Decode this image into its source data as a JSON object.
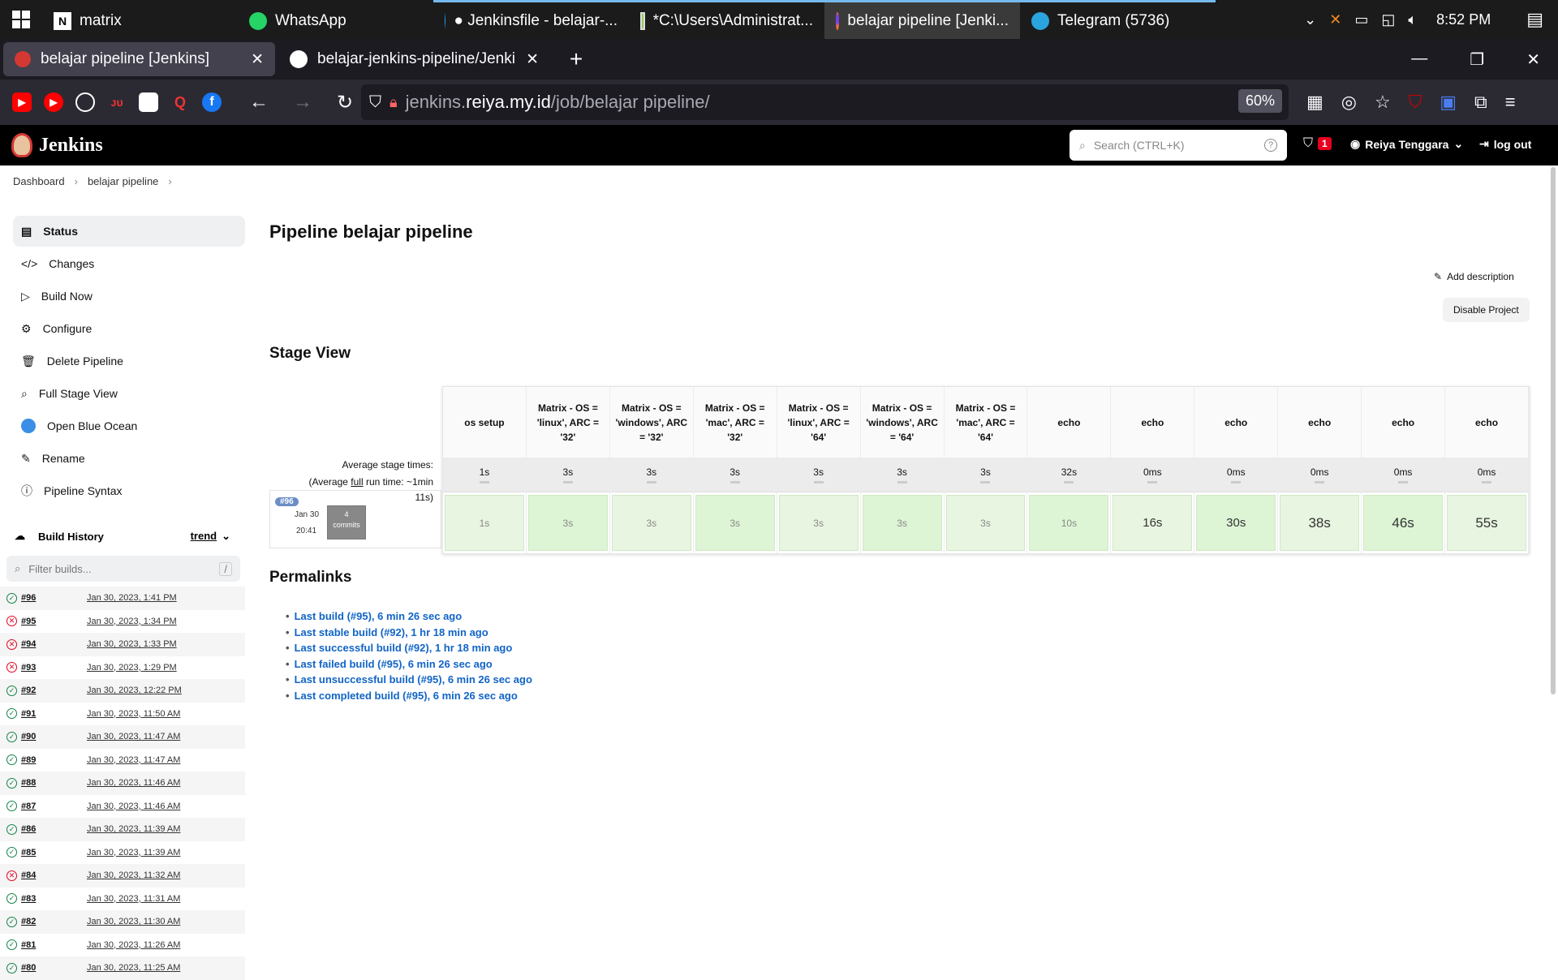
{
  "taskbar": {
    "apps": [
      {
        "label": "matrix",
        "icon": "notion-icon"
      },
      {
        "label": "WhatsApp",
        "icon": "whatsapp-icon"
      },
      {
        "label": "● Jenkinsfile - belajar-...",
        "icon": "vscode-icon"
      },
      {
        "label": "*C:\\Users\\Administrat...",
        "icon": "notepad-icon"
      },
      {
        "label": "belajar pipeline [Jenki...",
        "icon": "firefox-icon"
      },
      {
        "label": "Telegram (5736)",
        "icon": "telegram-icon"
      }
    ],
    "time": "8:52 PM"
  },
  "browser": {
    "tabs": [
      {
        "label": "belajar pipeline [Jenkins]"
      },
      {
        "label": "belajar-jenkins-pipeline/Jenki"
      }
    ],
    "url_prefix": "jenkins.",
    "url_host": "reiya.my.id",
    "url_path": "/job/belajar pipeline/",
    "zoom": "60%"
  },
  "jenkins": {
    "logo": "Jenkins",
    "search_placeholder": "Search (CTRL+K)",
    "alert_count": "1",
    "user": "Reiya Tenggara",
    "logout": "log out"
  },
  "breadcrumb": [
    "Dashboard",
    "belajar pipeline"
  ],
  "sidebar": {
    "items": [
      {
        "label": "Status",
        "icon": "status-icon"
      },
      {
        "label": "Changes",
        "icon": "code-icon"
      },
      {
        "label": "Build Now",
        "icon": "play-icon"
      },
      {
        "label": "Configure",
        "icon": "gear-icon"
      },
      {
        "label": "Delete Pipeline",
        "icon": "trash-icon"
      },
      {
        "label": "Full Stage View",
        "icon": "search-icon"
      },
      {
        "label": "Open Blue Ocean",
        "icon": "blue-ocean-icon"
      },
      {
        "label": "Rename",
        "icon": "pencil-icon"
      },
      {
        "label": "Pipeline Syntax",
        "icon": "help-icon"
      }
    ]
  },
  "build_history": {
    "title": "Build History",
    "trend": "trend",
    "filter_placeholder": "Filter builds...",
    "filter_key": "/",
    "builds": [
      {
        "num": "#96",
        "date": "Jan 30, 2023, 1:41 PM",
        "ok": true
      },
      {
        "num": "#95",
        "date": "Jan 30, 2023, 1:34 PM",
        "ok": false
      },
      {
        "num": "#94",
        "date": "Jan 30, 2023, 1:33 PM",
        "ok": false
      },
      {
        "num": "#93",
        "date": "Jan 30, 2023, 1:29 PM",
        "ok": false
      },
      {
        "num": "#92",
        "date": "Jan 30, 2023, 12:22 PM",
        "ok": true
      },
      {
        "num": "#91",
        "date": "Jan 30, 2023, 11:50 AM",
        "ok": true
      },
      {
        "num": "#90",
        "date": "Jan 30, 2023, 11:47 AM",
        "ok": true
      },
      {
        "num": "#89",
        "date": "Jan 30, 2023, 11:47 AM",
        "ok": true
      },
      {
        "num": "#88",
        "date": "Jan 30, 2023, 11:46 AM",
        "ok": true
      },
      {
        "num": "#87",
        "date": "Jan 30, 2023, 11:46 AM",
        "ok": true
      },
      {
        "num": "#86",
        "date": "Jan 30, 2023, 11:39 AM",
        "ok": true
      },
      {
        "num": "#85",
        "date": "Jan 30, 2023, 11:39 AM",
        "ok": true
      },
      {
        "num": "#84",
        "date": "Jan 30, 2023, 11:32 AM",
        "ok": false
      },
      {
        "num": "#83",
        "date": "Jan 30, 2023, 11:31 AM",
        "ok": true
      },
      {
        "num": "#82",
        "date": "Jan 30, 2023, 11:30 AM",
        "ok": true
      },
      {
        "num": "#81",
        "date": "Jan 30, 2023, 11:26 AM",
        "ok": true
      },
      {
        "num": "#80",
        "date": "Jan 30, 2023, 11:25 AM",
        "ok": true
      }
    ]
  },
  "main": {
    "title": "Pipeline belajar pipeline",
    "add_description": "Add description",
    "disable_project": "Disable Project",
    "stage_view_title": "Stage View",
    "avg_label": "Average stage times:",
    "avg_full_prefix": "(Average ",
    "avg_full_word": "full",
    "avg_full_suffix": " run time: ~1min",
    "avg_full_tail": "11s)",
    "build_badge": "#96",
    "build_date": "Jan 30",
    "build_time": "20:41",
    "commits_count": "4",
    "commits_label": "commits",
    "stages": [
      {
        "name": "os setup",
        "avg": "1s",
        "run": "1s"
      },
      {
        "name": "Matrix - OS = 'linux', ARC = '32'",
        "avg": "3s",
        "run": "3s"
      },
      {
        "name": "Matrix - OS = 'windows', ARC = '32'",
        "avg": "3s",
        "run": "3s"
      },
      {
        "name": "Matrix - OS = 'mac', ARC = '32'",
        "avg": "3s",
        "run": "3s"
      },
      {
        "name": "Matrix - OS = 'linux', ARC = '64'",
        "avg": "3s",
        "run": "3s"
      },
      {
        "name": "Matrix - OS = 'windows', ARC = '64'",
        "avg": "3s",
        "run": "3s"
      },
      {
        "name": "Matrix - OS = 'mac', ARC = '64'",
        "avg": "3s",
        "run": "3s"
      },
      {
        "name": "echo",
        "avg": "32s",
        "run": "10s"
      },
      {
        "name": "echo",
        "avg": "0ms",
        "run": "16s"
      },
      {
        "name": "echo",
        "avg": "0ms",
        "run": "30s"
      },
      {
        "name": "echo",
        "avg": "0ms",
        "run": "38s"
      },
      {
        "name": "echo",
        "avg": "0ms",
        "run": "46s"
      },
      {
        "name": "echo",
        "avg": "0ms",
        "run": "55s"
      }
    ],
    "permalinks_title": "Permalinks",
    "permalinks": [
      "Last build (#95), 6 min 26 sec ago",
      "Last stable build (#92), 1 hr 18 min ago",
      "Last successful build (#92), 1 hr 18 min ago",
      "Last failed build (#95), 6 min 26 sec ago",
      "Last unsuccessful build (#95), 6 min 26 sec ago",
      "Last completed build (#95), 6 min 26 sec ago"
    ]
  }
}
